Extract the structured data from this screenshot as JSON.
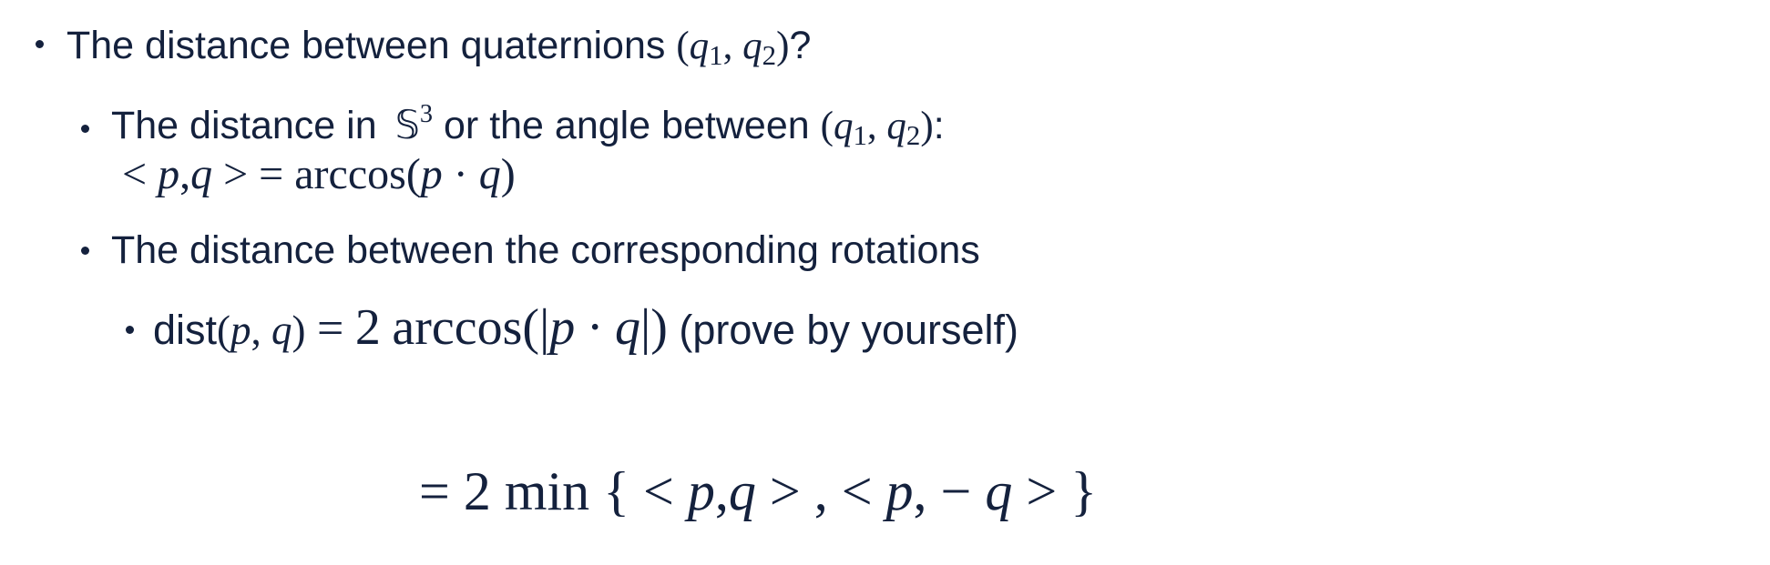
{
  "bullets": {
    "l1": {
      "text": "The distance between quaternions",
      "q1": "q",
      "q1_sub": "1",
      "q2": "q",
      "q2_sub": "2",
      "tail": "?"
    },
    "l2": {
      "text_a": "The distance in",
      "space": "𝕊",
      "space_sup": "3",
      "text_b": "or the angle between",
      "q1": "q",
      "q1_sub": "1",
      "q2": "q",
      "q2_sub": "2",
      "tail": ":"
    },
    "l2_formula": {
      "lt": "<",
      "p": "p",
      "comma": ",",
      "q": "q",
      "gt": ">",
      "eq": "=",
      "arccos": "arccos",
      "lparen": "(",
      "p2": "p",
      "dot": "·",
      "q2": "q",
      "rparen": ")"
    },
    "l3": {
      "text": "The distance between the corresponding rotations"
    },
    "l4": {
      "dist": "dist",
      "p": "p",
      "q": "q",
      "eq": "=",
      "two": "2",
      "arccos": "arccos",
      "pipe_l": "|",
      "p2": "p",
      "dot": "·",
      "q2": "q",
      "pipe_r": "|",
      "note": "(prove by yourself)"
    },
    "l5": {
      "eq": "=",
      "two": "2",
      "min": "min",
      "lbrace": "{",
      "lt1": "<",
      "p1": "p",
      "comma1": ",",
      "q1": "q",
      "gt1": ">",
      "sep": ",",
      "lt2": "<",
      "p2": "p",
      "comma2": ",",
      "minus": "−",
      "q2": "q",
      "gt2": ">",
      "rbrace": "}"
    }
  },
  "colors": {
    "text": "#14213d",
    "background": "#ffffff"
  }
}
